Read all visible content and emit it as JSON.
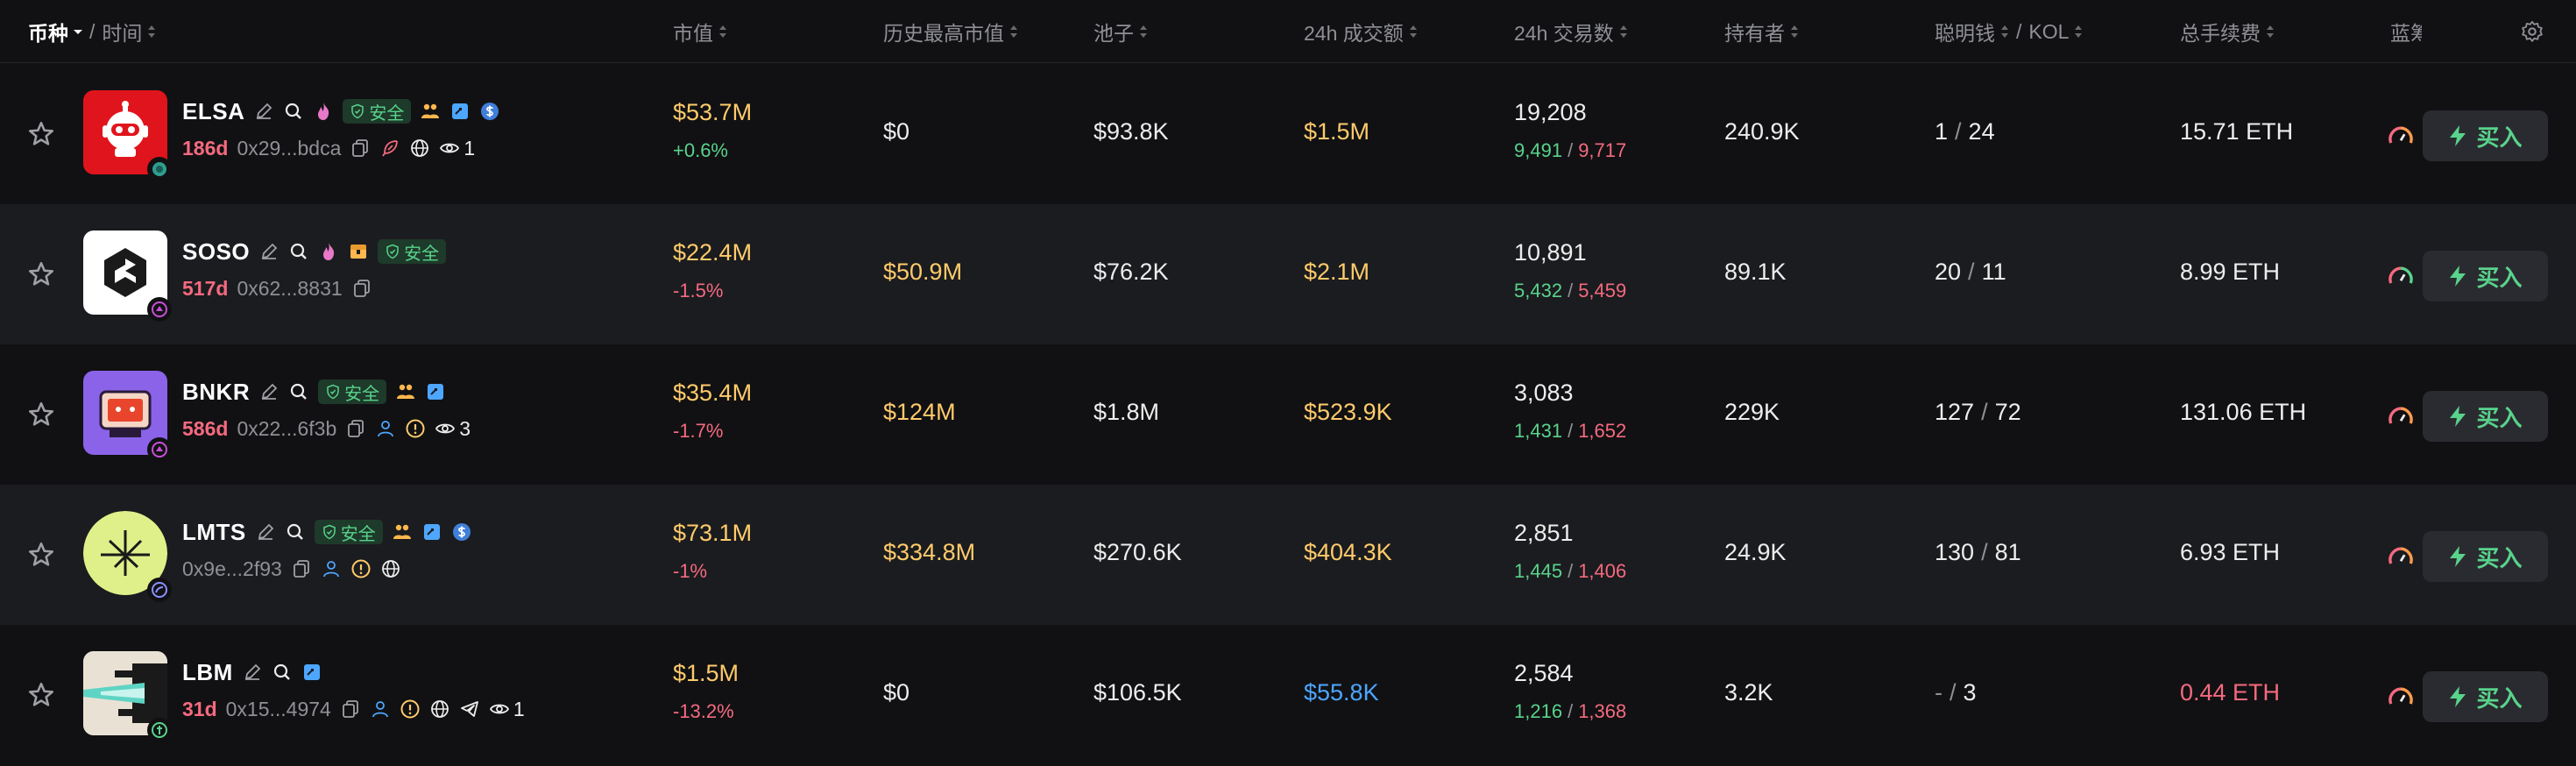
{
  "header": {
    "col_token": "币种",
    "col_sep": "/",
    "col_time": "时间",
    "col_mcap": "市值",
    "col_ath": "历史最高市值",
    "col_pool": "池子",
    "col_vol": "24h 成交额",
    "col_txs": "24h 交易数",
    "col_holders": "持有者",
    "col_smart": "聪明钱",
    "col_kol": "KOL",
    "col_fees": "总手续费",
    "col_bluechip": "蓝筹"
  },
  "rows": [
    {
      "symbol": "ELSA",
      "age": "186d",
      "address": "0x29...bdca",
      "safe": "安全",
      "views": "1",
      "mcap": "$53.7M",
      "change": "+0.6%",
      "ath": "$0",
      "pool": "$93.8K",
      "vol": "$1.5M",
      "txs": "19,208",
      "buys": "9,491",
      "sells": "9,717",
      "holders": "240.9K",
      "smart": "1",
      "kol": "24",
      "fees": "15.71 ETH",
      "buy_label": "买入"
    },
    {
      "symbol": "SOSO",
      "age": "517d",
      "address": "0x62...8831",
      "safe": "安全",
      "views": "",
      "mcap": "$22.4M",
      "change": "-1.5%",
      "ath": "$50.9M",
      "pool": "$76.2K",
      "vol": "$2.1M",
      "txs": "10,891",
      "buys": "5,432",
      "sells": "5,459",
      "holders": "89.1K",
      "smart": "20",
      "kol": "11",
      "fees": "8.99 ETH",
      "buy_label": "买入"
    },
    {
      "symbol": "BNKR",
      "age": "586d",
      "address": "0x22...6f3b",
      "safe": "安全",
      "views": "3",
      "mcap": "$35.4M",
      "change": "-1.7%",
      "ath": "$124M",
      "pool": "$1.8M",
      "vol": "$523.9K",
      "txs": "3,083",
      "buys": "1,431",
      "sells": "1,652",
      "holders": "229K",
      "smart": "127",
      "kol": "72",
      "fees": "131.06 ETH",
      "buy_label": "买入"
    },
    {
      "symbol": "LMTS",
      "age": "",
      "address": "0x9e...2f93",
      "safe": "安全",
      "views": "",
      "mcap": "$73.1M",
      "change": "-1%",
      "ath": "$334.8M",
      "pool": "$270.6K",
      "vol": "$404.3K",
      "txs": "2,851",
      "buys": "1,445",
      "sells": "1,406",
      "holders": "24.9K",
      "smart": "130",
      "kol": "81",
      "fees": "6.93 ETH",
      "buy_label": "买入"
    },
    {
      "symbol": "LBM",
      "age": "31d",
      "address": "0x15...4974",
      "safe": "",
      "views": "1",
      "mcap": "$1.5M",
      "change": "-13.2%",
      "ath": "$0",
      "pool": "$106.5K",
      "vol": "$55.8K",
      "txs": "2,584",
      "buys": "1,216",
      "sells": "1,368",
      "holders": "3.2K",
      "smart": "-",
      "kol": "3",
      "fees": "0.44 ETH",
      "buy_label": "买入"
    }
  ],
  "slash": "/",
  "colors": {
    "green": "#59d38c",
    "red": "#f56a7f",
    "yellow": "#ffcb6b",
    "blue": "#4da6ff"
  }
}
